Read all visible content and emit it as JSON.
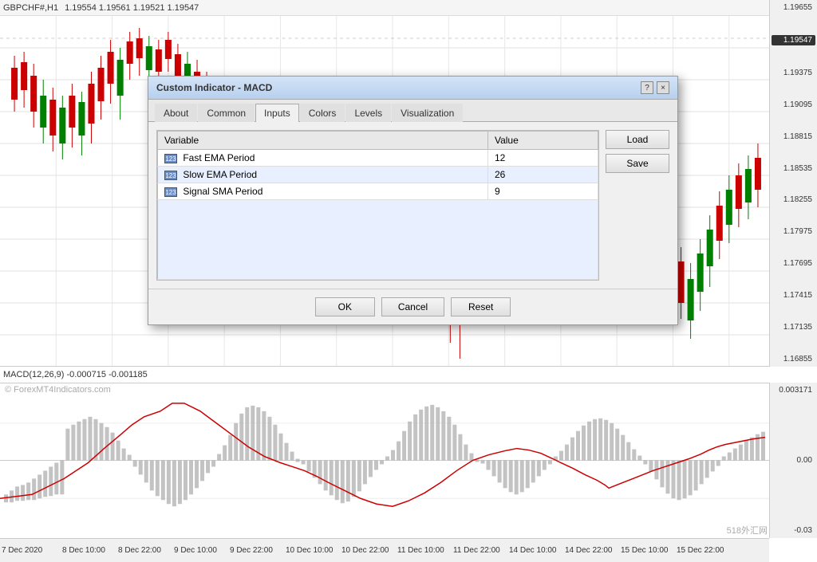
{
  "ticker": {
    "symbol": "GBPCHF#,H1",
    "prices": "1.19554  1.19561  1.19521  1.19547"
  },
  "priceAxis": {
    "values": [
      "1.19655",
      "1.19547",
      "1.19375",
      "1.19095",
      "1.18815",
      "1.18535",
      "1.18255",
      "1.17975",
      "1.17695",
      "1.17415",
      "1.17135",
      "1.16855"
    ]
  },
  "macdAxis": {
    "values": [
      "0.003171",
      "0.00",
      "-0.03"
    ]
  },
  "macdLabel": "MACD(12,26,9) -0.000715 -0.001185",
  "timeLabels": [
    "7 Dec 2020",
    "8 Dec 10:00",
    "8 Dec 22:00",
    "9 Dec 10:00",
    "9 Dec 22:00",
    "10 Dec 10:00",
    "10 Dec 22:00",
    "11 Dec 10:00",
    "11 Dec 22:00",
    "14 Dec 10:00",
    "14 Dec 22:00",
    "15 Dec 10:00",
    "15 Dec 22:00"
  ],
  "watermark": "© ForexMT4Indicators.com",
  "brand518": "518外汇网",
  "dialog": {
    "title": "Custom Indicator - MACD",
    "tabs": [
      "About",
      "Common",
      "Inputs",
      "Colors",
      "Levels",
      "Visualization"
    ],
    "activeTab": "Inputs",
    "table": {
      "headers": [
        "Variable",
        "Value"
      ],
      "rows": [
        {
          "icon": "123",
          "variable": "Fast EMA Period",
          "value": "12"
        },
        {
          "icon": "123",
          "variable": "Slow EMA Period",
          "value": "26"
        },
        {
          "icon": "123",
          "variable": "Signal SMA Period",
          "value": "9"
        }
      ]
    },
    "sideButtons": [
      "Load",
      "Save"
    ],
    "footerButtons": [
      "OK",
      "Cancel",
      "Reset"
    ],
    "helpBtn": "?",
    "closeBtn": "×"
  }
}
